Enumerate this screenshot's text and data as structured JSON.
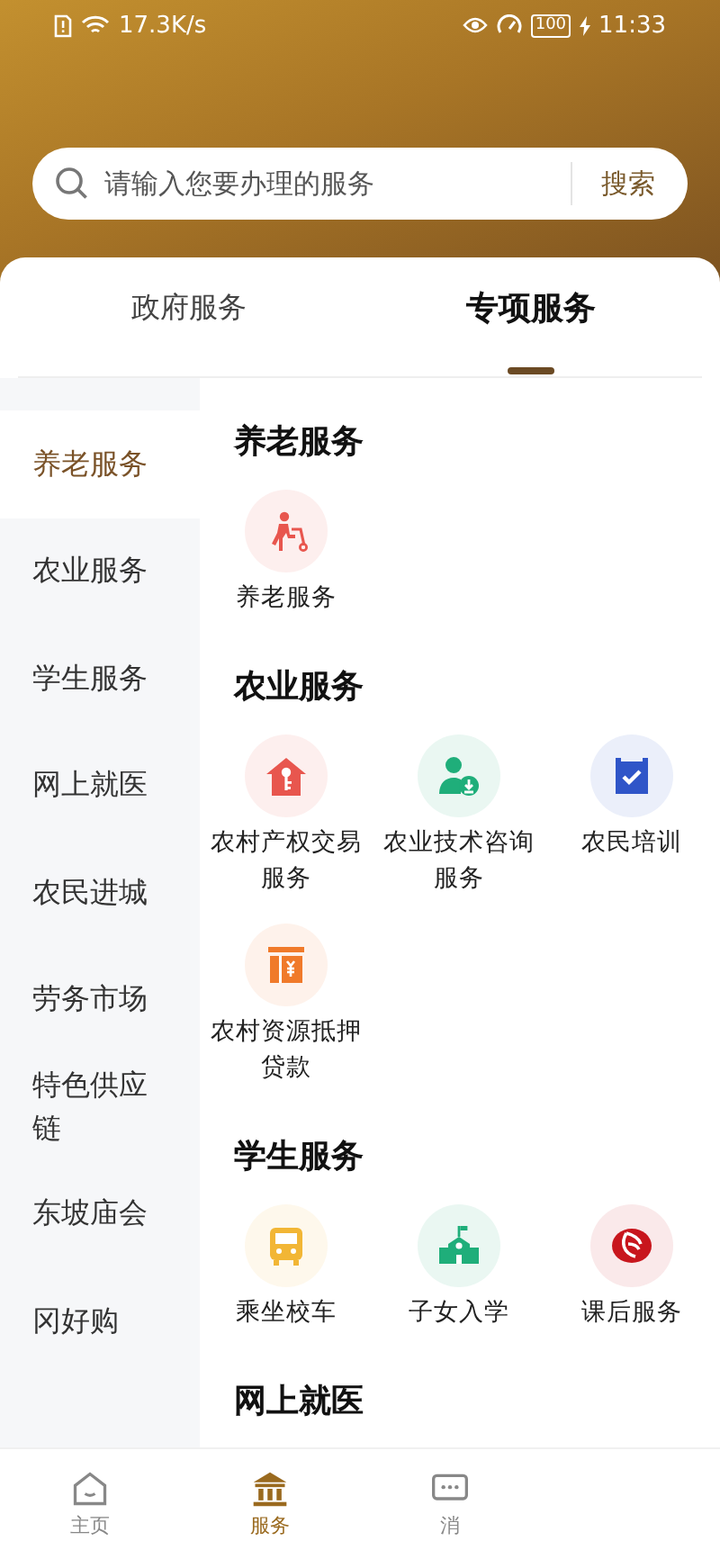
{
  "status_bar": {
    "speed": "17.3K/s",
    "battery": "100",
    "time": "11:33"
  },
  "search": {
    "placeholder": "请输入您要办理的服务",
    "button": "搜索"
  },
  "tabs": [
    {
      "label": "政府服务",
      "selected": false
    },
    {
      "label": "专项服务",
      "selected": true
    }
  ],
  "sidebar": {
    "items": [
      {
        "label": "养老服务",
        "selected": true
      },
      {
        "label": "农业服务",
        "selected": false
      },
      {
        "label": "学生服务",
        "selected": false
      },
      {
        "label": "网上就医",
        "selected": false
      },
      {
        "label": "农民进城",
        "selected": false
      },
      {
        "label": "劳务市场",
        "selected": false
      },
      {
        "label": "特色供应链",
        "selected": false
      },
      {
        "label": "东坡庙会",
        "selected": false
      },
      {
        "label": "冈好购",
        "selected": false
      }
    ]
  },
  "sections": [
    {
      "title": "养老服务",
      "services": [
        {
          "label": "养老服务",
          "color": "#e8564e"
        }
      ]
    },
    {
      "title": "农业服务",
      "services": [
        {
          "label": "农村产权交易服务",
          "color": "#e8564e"
        },
        {
          "label": "农业技术咨询服务",
          "color": "#1fae7a"
        },
        {
          "label": "农民培训",
          "color": "#2f55c8"
        },
        {
          "label": "农村资源抵押贷款",
          "color": "#f07a2a"
        }
      ]
    },
    {
      "title": "学生服务",
      "services": [
        {
          "label": "乘坐校车",
          "color": "#f2b635"
        },
        {
          "label": "子女入学",
          "color": "#1fae7a"
        },
        {
          "label": "课后服务",
          "color": "#c8161d"
        }
      ]
    },
    {
      "title": "网上就医"
    }
  ],
  "bottom_nav": [
    {
      "label": "主页",
      "selected": false
    },
    {
      "label": "服务",
      "selected": true
    },
    {
      "label": "消",
      "selected": false
    }
  ]
}
